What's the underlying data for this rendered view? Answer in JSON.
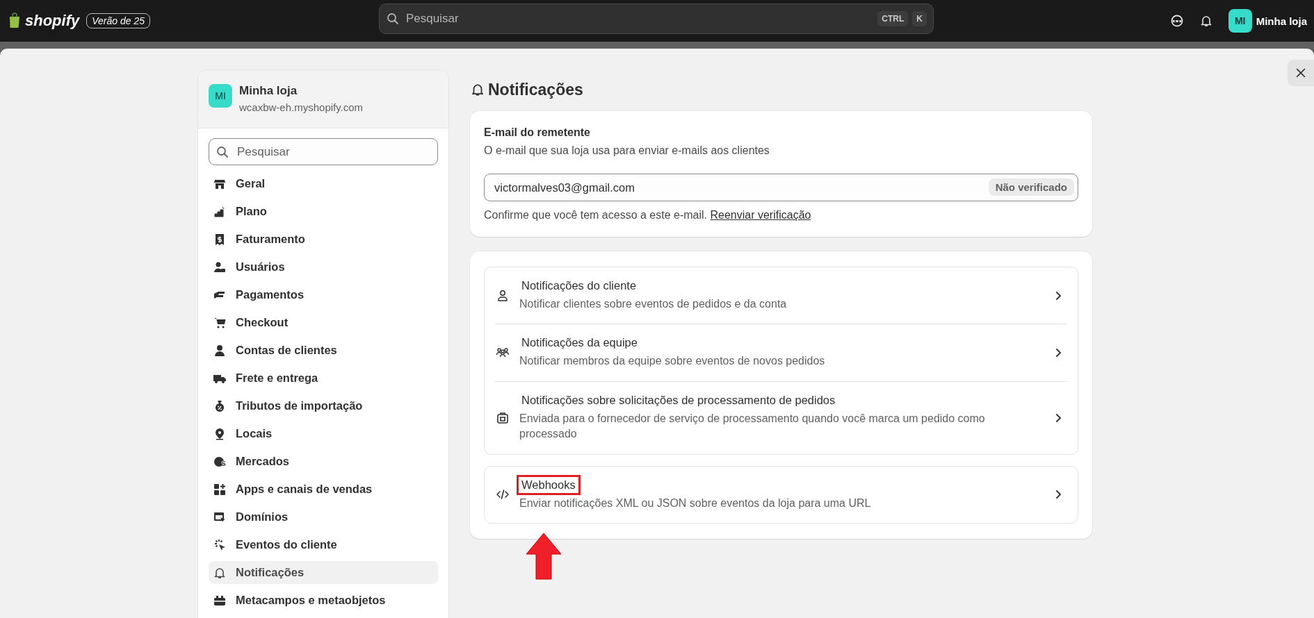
{
  "topbar": {
    "logo": "shopify",
    "badge": "Verão de 25",
    "search": {
      "placeholder": "Pesquisar",
      "keys": [
        "CTRL",
        "K"
      ]
    },
    "store": {
      "initials": "MI",
      "name": "Minha loja"
    }
  },
  "sidebar": {
    "store": {
      "initials": "MI",
      "name": "Minha loja",
      "domain": "wcaxbw-eh.myshopify.com"
    },
    "search": {
      "placeholder": "Pesquisar"
    },
    "items": [
      {
        "label": "Geral",
        "selected": false
      },
      {
        "label": "Plano",
        "selected": false
      },
      {
        "label": "Faturamento",
        "selected": false
      },
      {
        "label": "Usuários",
        "selected": false
      },
      {
        "label": "Pagamentos",
        "selected": false
      },
      {
        "label": "Checkout",
        "selected": false
      },
      {
        "label": "Contas de clientes",
        "selected": false
      },
      {
        "label": "Frete e entrega",
        "selected": false
      },
      {
        "label": "Tributos de importação",
        "selected": false
      },
      {
        "label": "Locais",
        "selected": false
      },
      {
        "label": "Mercados",
        "selected": false
      },
      {
        "label": "Apps e canais de vendas",
        "selected": false
      },
      {
        "label": "Domínios",
        "selected": false
      },
      {
        "label": "Eventos do cliente",
        "selected": false
      },
      {
        "label": "Notificações",
        "selected": true
      },
      {
        "label": "Metacampos e metaobjetos",
        "selected": false
      }
    ]
  },
  "page": {
    "title": "Notificações",
    "sender": {
      "title": "E-mail do remetente",
      "description": "O e-mail que sua loja usa para enviar e-mails aos clientes",
      "value": "victormalves03@gmail.com",
      "badge": "Não verificado",
      "note": "Confirme que você tem acesso a este e-mail.",
      "link": "Reenviar verificação"
    },
    "groups": [
      {
        "items": [
          {
            "title": "Notificações do cliente",
            "description": "Notificar clientes sobre eventos de pedidos e da conta",
            "highlighted": false
          },
          {
            "title": "Notificações da equipe",
            "description": "Notificar membros da equipe sobre eventos de novos pedidos",
            "highlighted": false
          },
          {
            "title": "Notificações sobre solicitações de processamento de pedidos",
            "description": "Enviada para o fornecedor de serviço de processamento quando você marca um pedido como processado",
            "highlighted": false
          }
        ]
      },
      {
        "items": [
          {
            "title": "Webhooks",
            "description": "Enviar notificações XML ou JSON sobre eventos da loja para uma URL",
            "highlighted": true
          }
        ]
      }
    ]
  }
}
